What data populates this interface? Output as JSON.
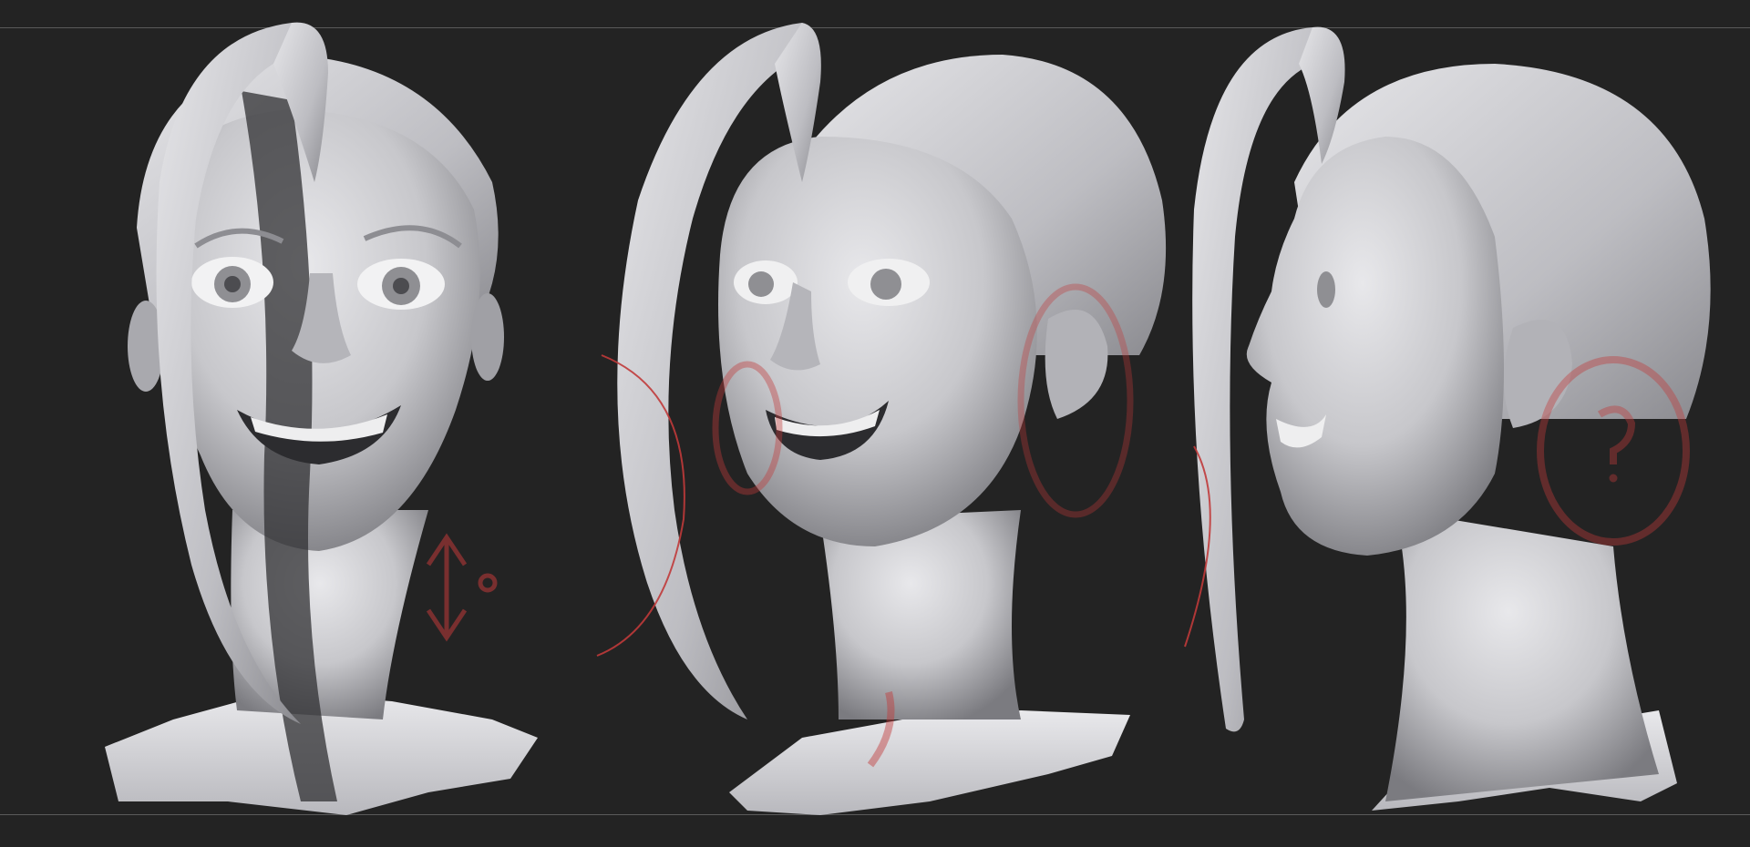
{
  "scene": {
    "views": [
      "front-three-quarter",
      "three-quarter",
      "side-profile"
    ],
    "colors": {
      "background": "#232323",
      "guide": "#5a5a5a",
      "clay": "#c9c9cc",
      "clay_light": "#e4e4e7",
      "clay_shadow": "#6e6e72",
      "annotation": "#c03a3a"
    },
    "annotation_icons": [
      "arrow-annotation-icon",
      "circle-annotation-icon",
      "question-annotation-icon"
    ]
  }
}
